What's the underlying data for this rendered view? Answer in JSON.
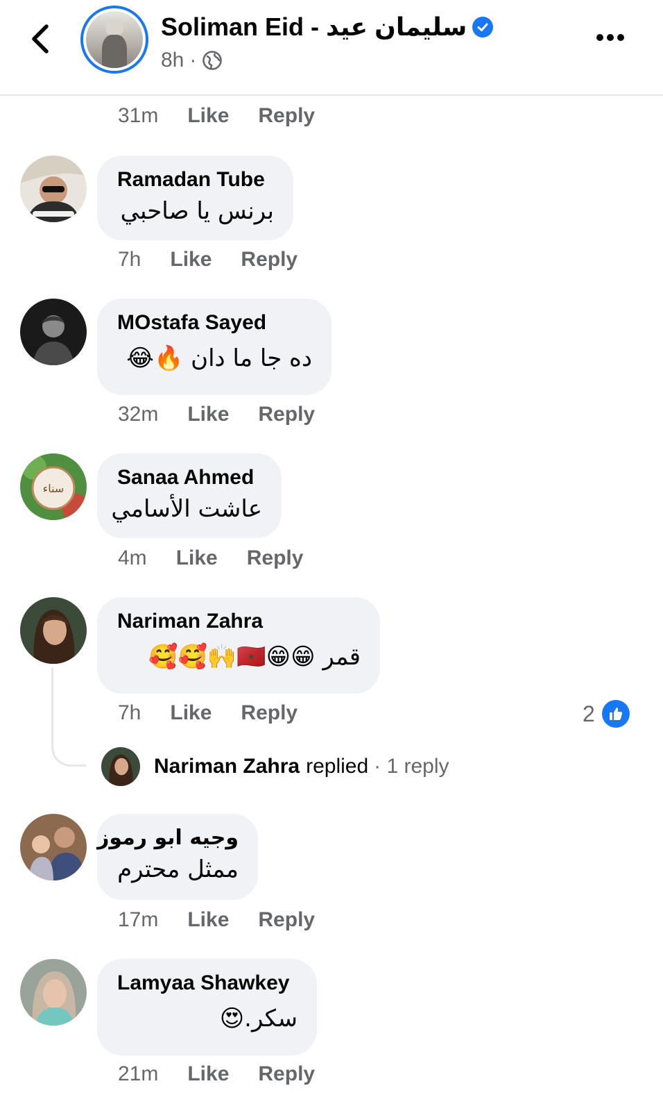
{
  "header": {
    "name": "Soliman Eid - سليمان عيد",
    "time": "8h",
    "separator": "·",
    "privacy_icon": "globe-icon"
  },
  "top_actions": {
    "time": "31m",
    "like": "Like",
    "reply": "Reply"
  },
  "comments": [
    {
      "author": "Ramadan Tube",
      "text": "برنس يا صاحبي",
      "time": "7h",
      "like": "Like",
      "reply": "Reply"
    },
    {
      "author": "MOstafa Sayed",
      "text": "ده جا ما دان 🔥😂",
      "time": "32m",
      "like": "Like",
      "reply": "Reply"
    },
    {
      "author": "Sanaa Ahmed",
      "text": "عاشت الأسامي",
      "time": "4m",
      "like": "Like",
      "reply": "Reply",
      "avatar_text": "سناء"
    },
    {
      "author": "Nariman Zahra",
      "text": "قمر 😁😁🇲🇦🙌🥰🥰",
      "time": "7h",
      "like": "Like",
      "reply": "Reply",
      "reactions": "2"
    },
    {
      "author": "وجيه ابو رموز",
      "text": "ممثل محترم",
      "time": "17m",
      "like": "Like",
      "reply": "Reply"
    },
    {
      "author": "Lamyaa Shawkey",
      "text": "سكر.😍",
      "time": "21m",
      "like": "Like",
      "reply": "Reply"
    }
  ],
  "reply_preview": {
    "name": "Nariman Zahra",
    "verb": "replied",
    "count": "· 1 reply"
  },
  "colors": {
    "accent": "#1877f2",
    "bubble": "#f0f2f5",
    "muted": "#65676b"
  }
}
